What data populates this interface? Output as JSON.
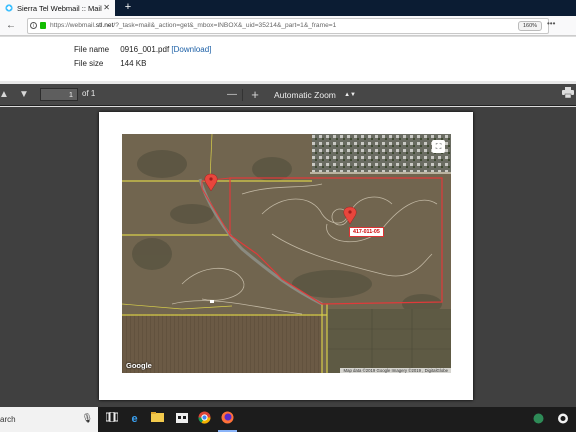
{
  "browser": {
    "tab_title": "Sierra Tel Webmail :: Mail",
    "tab_close": "✕",
    "new_tab": "+",
    "url_prefix": "https://webmail.",
    "url_domain": "stl.net",
    "url_rest": "/?_task=mail&_action=get&_mbox=INBOX&_uid=35214&_part=1&_frame=1",
    "zoom_badge": "160%",
    "menu_dots": "•••"
  },
  "attachment": {
    "file_name_label": "File name",
    "file_name": "0916_001.pdf",
    "download_label": "[Download]",
    "file_size_label": "File size",
    "file_size": "144 KB"
  },
  "pdf_toolbar": {
    "page_number": "1",
    "page_count": "of 1",
    "zoom_out": "—",
    "zoom_in": "+",
    "zoom_mode": "Automatic Zoom"
  },
  "map": {
    "parcel_label": "417-011-05",
    "google_logo": "Google",
    "attribution": "Map data ©2019 Google Imagery ©2019 , DigitalGlobe"
  },
  "taskbar": {
    "search_text": "arch"
  }
}
